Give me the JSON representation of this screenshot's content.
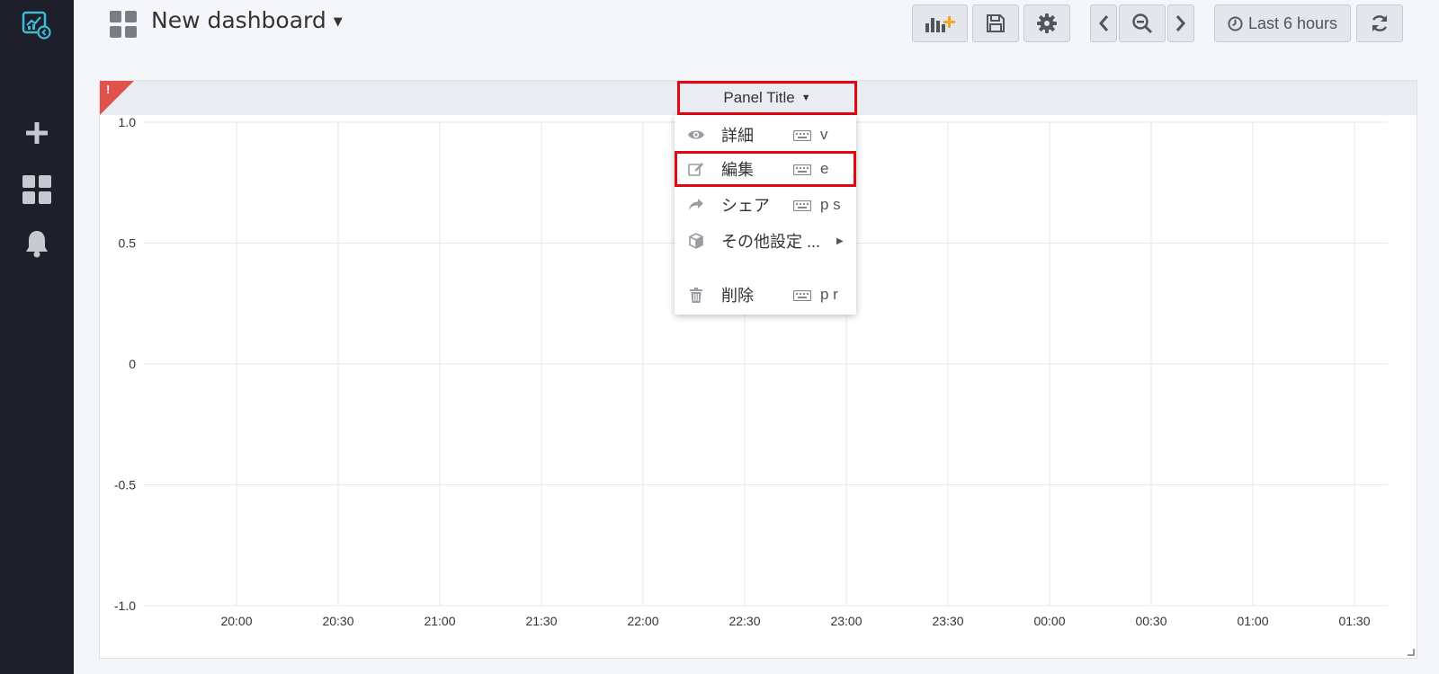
{
  "sidebar": {
    "logo_icon": "grafana-logo-icon",
    "items": [
      {
        "icon": "plus-icon",
        "name": "create"
      },
      {
        "icon": "dashboards-grid-icon",
        "name": "dashboards"
      },
      {
        "icon": "bell-icon",
        "name": "alerting"
      }
    ]
  },
  "header": {
    "dashboard_title": "New dashboard",
    "buttons": [
      {
        "icon": "add-panel-icon"
      },
      {
        "icon": "save-icon"
      },
      {
        "icon": "gear-icon"
      },
      {
        "icon": "chevron-left-icon"
      },
      {
        "icon": "zoom-out-icon"
      },
      {
        "icon": "chevron-right-icon"
      },
      {
        "icon": "refresh-icon"
      }
    ],
    "time_range": "Last 6 hours"
  },
  "panel": {
    "title": "Panel Title",
    "error_indicator": "!"
  },
  "menu": {
    "items": [
      {
        "label": "詳細",
        "shortcut": "v",
        "icon": "eye-icon"
      },
      {
        "label": "編集",
        "shortcut": "e",
        "icon": "edit-icon"
      },
      {
        "label": "シェア",
        "shortcut": "p s",
        "icon": "share-icon"
      },
      {
        "label": "その他設定 ...",
        "shortcut": "",
        "icon": "cube-icon",
        "submenu": true
      },
      {
        "label": "削除",
        "shortcut": "p r",
        "icon": "trash-icon"
      }
    ]
  },
  "chart_data": {
    "type": "line",
    "title": "Panel Title",
    "x_ticks": [
      "20:00",
      "20:30",
      "21:00",
      "21:30",
      "22:00",
      "22:30",
      "23:00",
      "23:30",
      "00:00",
      "00:30",
      "01:00",
      "01:30"
    ],
    "y_ticks": [
      "1.0",
      "0.5",
      "0",
      "-0.5",
      "-1.0"
    ],
    "ylim": [
      -1.0,
      1.0
    ],
    "series": [],
    "grid": true,
    "colors": {
      "grid": "#e6e7ea",
      "tick_text": "#333333"
    }
  }
}
